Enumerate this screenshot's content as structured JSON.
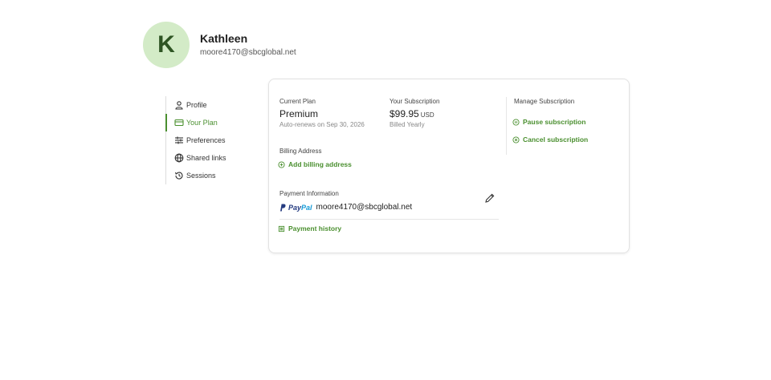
{
  "user": {
    "initial": "K",
    "name": "Kathleen",
    "email": "moore4170@sbcglobal.net"
  },
  "nav": {
    "items": [
      {
        "label": "Profile",
        "icon": "person-icon"
      },
      {
        "label": "Your Plan",
        "icon": "card-icon",
        "active": true
      },
      {
        "label": "Preferences",
        "icon": "sliders-icon"
      },
      {
        "label": "Shared links",
        "icon": "globe-icon"
      },
      {
        "label": "Sessions",
        "icon": "history-icon"
      }
    ]
  },
  "plan": {
    "current_label": "Current Plan",
    "current_name": "Premium",
    "renew_text": "Auto-renews on Sep 30, 2026",
    "subscription_label": "Your Subscription",
    "price": "$99.95",
    "currency": "USD",
    "billing_cycle": "Billed Yearly"
  },
  "manage": {
    "title": "Manage Subscription",
    "pause": "Pause subscription",
    "cancel": "Cancel subscription"
  },
  "billing": {
    "label": "Billing Address",
    "add": "Add billing address"
  },
  "payment": {
    "label": "Payment Information",
    "provider_a": "Pay",
    "provider_b": "Pal",
    "email": "moore4170@sbcglobal.net",
    "history": "Payment history"
  },
  "colors": {
    "accent": "#4a8f2f",
    "avatar_bg": "#d3ebc7",
    "avatar_text": "#2f5524"
  }
}
